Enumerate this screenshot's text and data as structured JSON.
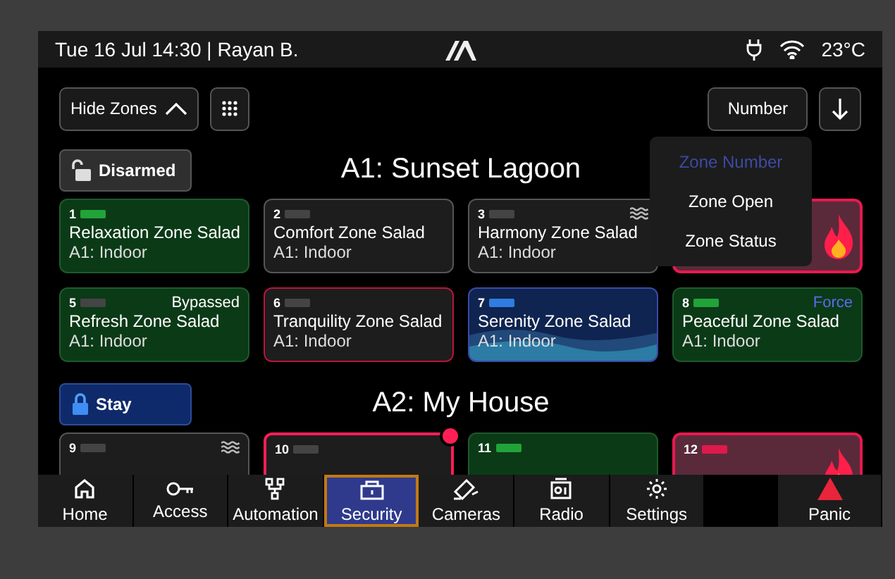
{
  "status_bar": {
    "datetime_user": "Tue 16 Jul 14:30 | Rayan B.",
    "temperature": "23°C"
  },
  "toolbar": {
    "hide_zones": "Hide Zones",
    "sort": "Number"
  },
  "sort_menu": [
    {
      "label": "Zone Number",
      "selected": true
    },
    {
      "label": "Zone Open",
      "selected": false
    },
    {
      "label": "Zone Status",
      "selected": false
    }
  ],
  "areas": [
    {
      "title": "A1: Sunset Lagoon",
      "arm": {
        "label": "Disarmed",
        "kind": "disarmed"
      },
      "zones": [
        {
          "number": "1",
          "name": "Relaxation Zone Salad",
          "area": "A1: Indoor",
          "kind": "ready",
          "color": "#22a33a"
        },
        {
          "number": "2",
          "name": "Comfort Zone Salad",
          "area": "A1: Indoor",
          "kind": "idle",
          "color": "#444444"
        },
        {
          "number": "3",
          "name": "Harmony Zone Salad",
          "area": "A1: Indoor",
          "kind": "water",
          "color": "#444444"
        },
        {
          "kind": "fire"
        },
        {
          "number": "5",
          "name": "Refresh Zone Salad",
          "area": "A1: Indoor",
          "kind": "ready",
          "color": "#444444",
          "tag": {
            "text": "Bypassed",
            "kind": "bypass"
          }
        },
        {
          "number": "6",
          "name": "Tranquility Zone Salad",
          "area": "A1: Indoor",
          "kind": "fault",
          "color": "#444444"
        },
        {
          "number": "7",
          "name": "Serenity Zone Salad",
          "area": "A1: Indoor",
          "kind": "active",
          "color": "#2f7de0"
        },
        {
          "number": "8",
          "name": "Peaceful Zone Salad",
          "area": "A1: Indoor",
          "kind": "ready",
          "color": "#22a33a",
          "tag": {
            "text": "Force",
            "kind": "force"
          }
        }
      ]
    },
    {
      "title": "A2: My House",
      "arm": {
        "label": "Stay",
        "kind": "stay"
      },
      "zones": [
        {
          "number": "9",
          "kind": "water",
          "color": "#444444"
        },
        {
          "number": "10",
          "kind": "alarm",
          "color": "#444444"
        },
        {
          "number": "11",
          "kind": "ready",
          "color": "#22a33a"
        },
        {
          "number": "12",
          "kind": "fire",
          "color": "#e0194d"
        }
      ]
    }
  ],
  "nav": [
    {
      "label": "Home",
      "selected": false
    },
    {
      "label": "Access",
      "selected": false
    },
    {
      "label": "Automation",
      "selected": false
    },
    {
      "label": "Security",
      "selected": true
    },
    {
      "label": "Cameras",
      "selected": false
    },
    {
      "label": "Radio",
      "selected": false
    },
    {
      "label": "Settings",
      "selected": false
    }
  ],
  "panic": "Panic"
}
